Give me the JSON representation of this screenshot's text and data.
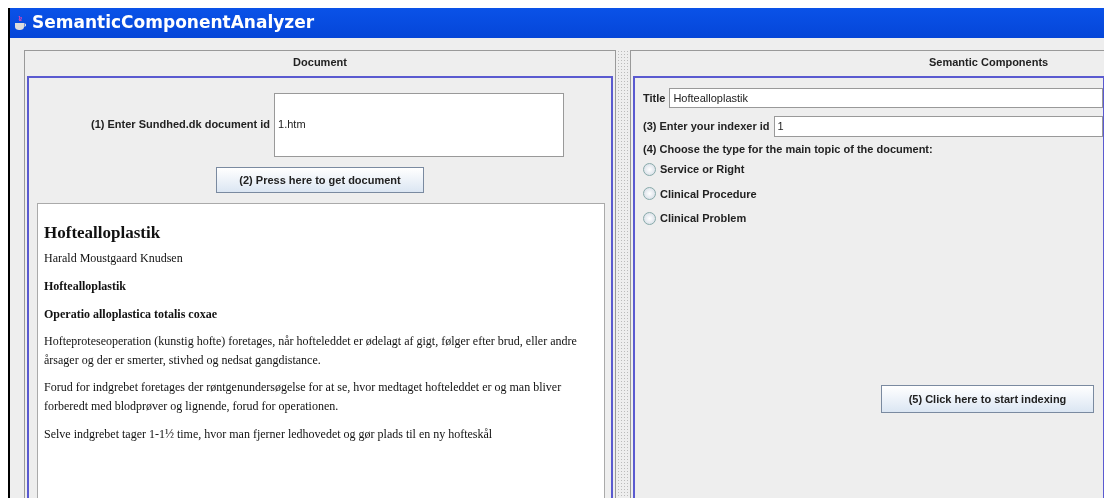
{
  "window": {
    "title": "SemanticComponentAnalyzer"
  },
  "document_panel": {
    "header": "Document",
    "id_label": "(1) Enter Sundhed.dk document id",
    "id_value": "1.htm",
    "get_button": "(2) Press here to get document",
    "content": [
      {
        "kind": "heading",
        "text": "Hoftealloplastik"
      },
      {
        "kind": "paragraph",
        "text": "Harald Moustgaard Knudsen"
      },
      {
        "kind": "bold",
        "text": "Hoftealloplastik"
      },
      {
        "kind": "bold",
        "text": "Operatio alloplastica totalis coxae"
      },
      {
        "kind": "paragraph",
        "text": "Hofteproteseoperation (kunstig hofte) foretages, når hofteleddet er ødelagt af gigt, følger efter brud, eller andre årsager og der er smerter, stivhed og nedsat gangdistance."
      },
      {
        "kind": "paragraph",
        "text": "Forud for indgrebet foretages der røntgenundersøgelse for at se, hvor medtaget hofteleddet er og man bliver forberedt med blodprøver og lignende, forud for operationen."
      },
      {
        "kind": "paragraph",
        "text": "Selve indgrebet tager 1-1½ time, hvor man fjerner ledhovedet og gør plads til en ny hofteskål"
      }
    ]
  },
  "semantic_panel": {
    "header": "Semantic Components",
    "title_label": "Title",
    "title_value": "Hoftealloplastik",
    "indexer_label": "(3) Enter your indexer id",
    "indexer_value": "1",
    "type_prompt": "(4) Choose the type for the main topic of the document:",
    "types": [
      {
        "label": "Service or Right",
        "selected": false
      },
      {
        "label": "Clinical Procedure",
        "selected": false
      },
      {
        "label": "Clinical Problem",
        "selected": false
      }
    ],
    "index_button": "(5) Click here to start indexing"
  }
}
